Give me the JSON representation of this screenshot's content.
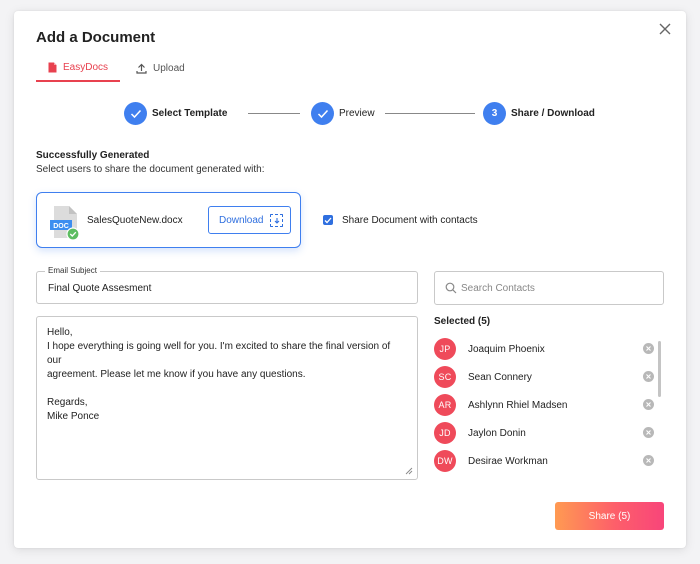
{
  "dialog": {
    "title": "Add a Document",
    "close_icon": "close-icon"
  },
  "tabs": [
    {
      "label": "EasyDocs",
      "icon": "document-icon",
      "active": true
    },
    {
      "label": "Upload",
      "icon": "upload-icon",
      "active": false
    }
  ],
  "stepper": {
    "steps": [
      {
        "label": "Select Template",
        "state": "completed",
        "marker": "check"
      },
      {
        "label": "Preview",
        "state": "completed",
        "marker": "check"
      },
      {
        "label": "Share / Download",
        "state": "active",
        "marker": "3"
      }
    ]
  },
  "status": {
    "title": "Successfully Generated",
    "subtitle": "Select users to share the document generated with:"
  },
  "document": {
    "badge": "DOC",
    "filename": "SalesQuoteNew.docx",
    "download_label": "Download"
  },
  "share_option": {
    "label": "Share Document with contacts",
    "checked": true
  },
  "email": {
    "subject_label": "Email Subject",
    "subject_value": "Final Quote Assesment",
    "body_lines": [
      "Hello,",
      "I hope everything is going well for you. I'm excited to share the final version of our",
      "agreement. Please let me know if you have any questions.",
      "",
      "Regards,",
      "Mike Ponce"
    ]
  },
  "contacts": {
    "search_placeholder": "Search Contacts",
    "selected_label": "Selected (5)",
    "list": [
      {
        "initials": "JP",
        "name": "Joaquim Phoenix"
      },
      {
        "initials": "SC",
        "name": "Sean Connery"
      },
      {
        "initials": "AR",
        "name": "Ashlynn Rhiel Madsen"
      },
      {
        "initials": "JD",
        "name": "Jaylon Donin"
      },
      {
        "initials": "DW",
        "name": "Desirae Workman"
      }
    ]
  },
  "actions": {
    "share_label": "Share (5)"
  },
  "colors": {
    "accent_red": "#e8414f",
    "primary_blue": "#3f7fef",
    "avatar_red": "#ef4a5a"
  }
}
